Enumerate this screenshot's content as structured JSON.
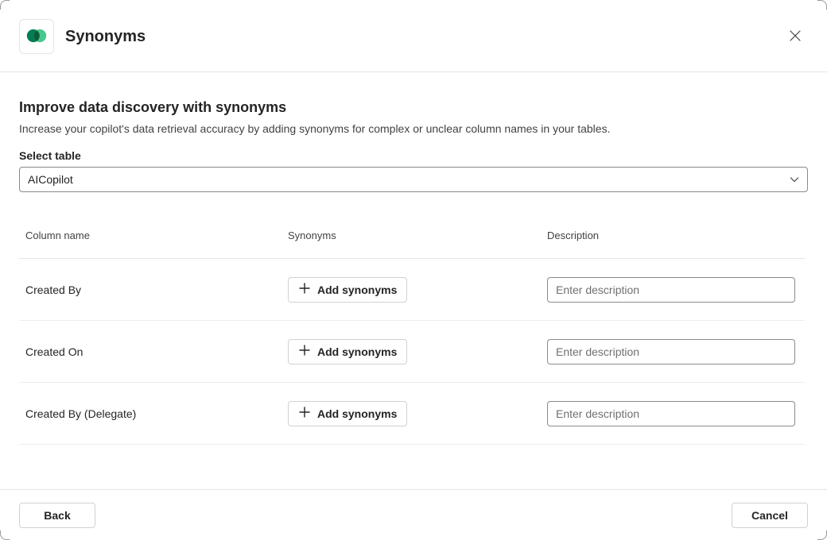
{
  "header": {
    "title": "Synonyms"
  },
  "section": {
    "title": "Improve data discovery with synonyms",
    "description": "Increase your copilot's data retrieval accuracy by adding synonyms for complex or unclear column names in your tables."
  },
  "table_field": {
    "label": "Select table",
    "selected": "AICopilot"
  },
  "columns_header": {
    "name": "Column name",
    "synonyms": "Synonyms",
    "description": "Description"
  },
  "add_synonyms_label": "Add synonyms",
  "desc_placeholder": "Enter description",
  "rows": {
    "0": {
      "name": "Created By"
    },
    "1": {
      "name": "Created On"
    },
    "2": {
      "name": "Created By (Delegate)"
    }
  },
  "footer": {
    "back": "Back",
    "cancel": "Cancel"
  }
}
